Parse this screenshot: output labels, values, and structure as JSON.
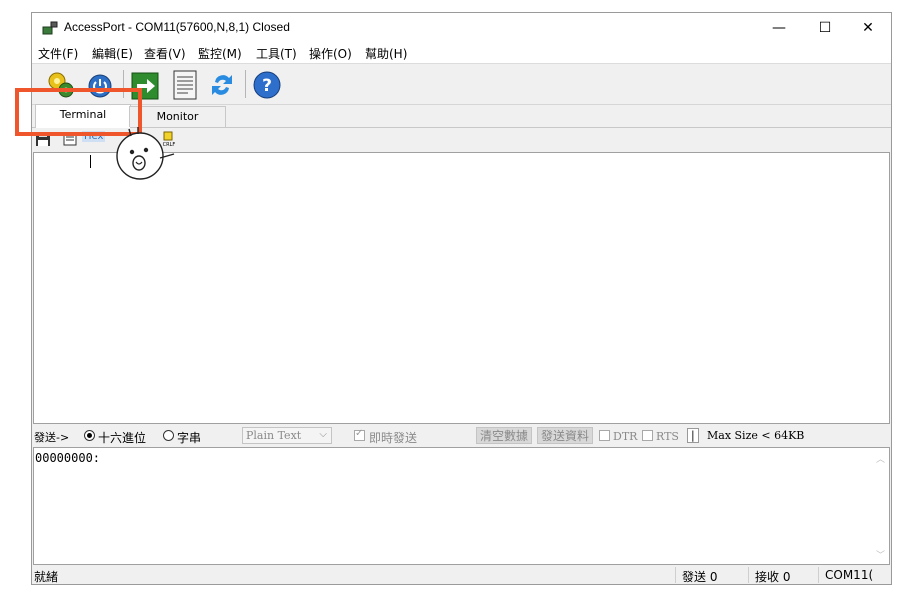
{
  "window": {
    "title": "AccessPort - COM11(57600,N,8,1) Closed",
    "controls": {
      "minimize": "—",
      "maximize": "☐",
      "close": "✕"
    }
  },
  "menu": [
    "文件(F)",
    "編輯(E)",
    "查看(V)",
    "監控(M)",
    "工具(T)",
    "操作(O)",
    "幫助(H)"
  ],
  "toolbar": {
    "icons": [
      "settings-gear-icon",
      "power-icon",
      "send-arrow-icon",
      "document-icon",
      "refresh-arrows-icon",
      "help-icon"
    ]
  },
  "tabs": [
    {
      "label": "Terminal",
      "active": true
    },
    {
      "label": "Monitor",
      "active": false
    }
  ],
  "subtoolbar": {
    "hex_label": "Hex",
    "crlf_label": "CRLF"
  },
  "send_bar": {
    "label": "發送->",
    "radio_hex": "十六進位",
    "radio_char": "字串",
    "format_select": "Plain Text",
    "realtime_send": "即時發送",
    "clear_data": "清空數據",
    "send_data": "發送資料",
    "dtr": "DTR",
    "rts": "RTS",
    "sep": "|",
    "max_size": "Max Size < 64KB"
  },
  "editor": {
    "text": "00000000:"
  },
  "status": {
    "ready": "就緒",
    "sent": "發送 0",
    "received": "接收 0",
    "port": "COM11("
  },
  "colors": {
    "highlight": "#f0562c",
    "accent_blue": "#1a5fb4",
    "green": "#2e8b2e"
  }
}
